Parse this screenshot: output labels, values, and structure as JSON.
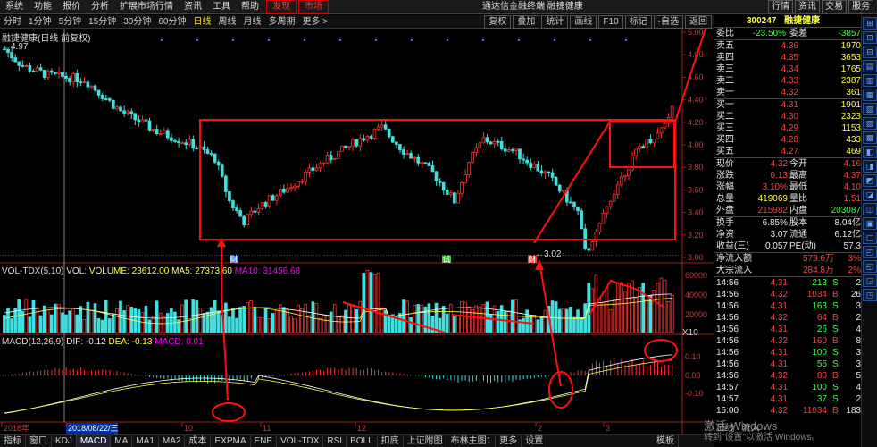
{
  "menu": {
    "items": [
      "系统",
      "功能",
      "报价",
      "分析",
      "扩展市场行情",
      "资讯",
      "工具",
      "帮助"
    ],
    "hot": [
      "发现",
      "市场"
    ],
    "title": "通达信金融终端 融捷健康",
    "right_buttons": [
      "行情",
      "资讯",
      "交易",
      "服务"
    ]
  },
  "toolbar": {
    "periods": [
      "分时",
      "1分钟",
      "5分钟",
      "15分钟",
      "30分钟",
      "60分钟",
      "日线",
      "周线",
      "月线",
      "多周期",
      "更多 >"
    ],
    "active": "日线",
    "right": [
      "复权",
      "叠加",
      "统计",
      "画线",
      "F10",
      "标记",
      "-自选",
      "返回"
    ]
  },
  "chart": {
    "name": "融捷健康(日线 前复权)",
    "start_price": "4.97",
    "low_label": "3.02",
    "price_axis": [
      "5.00",
      "4.80",
      "4.60",
      "4.40",
      "4.20",
      "4.00",
      "3.80",
      "3.60",
      "3.40",
      "3.20",
      "3.00"
    ],
    "vol_header": "VOL-TDX(5,10)  VOL: ",
    "vol_volume": "VOLUME: 23612.00",
    "vol_ma5": "MA5: 27373.60",
    "vol_ma10": "MA10: 31456.68",
    "vol_axis": [
      "60000",
      "40000",
      "20000"
    ],
    "vol_unit": "X10",
    "macd_header": "MACD(12,26,9)",
    "macd_dif": "DIF: -0.12",
    "macd_dea": "DEA: -0.13",
    "macd_val": "MACD: 0.01",
    "macd_axis": [
      "0.10",
      "0.00",
      "-0.10"
    ],
    "date_labels": [
      "2018年",
      "2018/08/22/三",
      "10",
      "11",
      "12",
      "2",
      "3"
    ],
    "markers": [
      "财",
      "试",
      "财"
    ]
  },
  "quote": {
    "code": "300247",
    "name": "融捷健康",
    "weibi_label": "委比",
    "weibi": "-23.50%",
    "weicha_label": "委差",
    "weicha": "-3857",
    "sell": [
      {
        "label": "卖五",
        "price": "4.36",
        "vol": "1970"
      },
      {
        "label": "卖四",
        "price": "4.35",
        "vol": "3653"
      },
      {
        "label": "卖三",
        "price": "4.34",
        "vol": "1765"
      },
      {
        "label": "卖二",
        "price": "4.33",
        "vol": "2387"
      },
      {
        "label": "卖一",
        "price": "4.32",
        "vol": "361"
      }
    ],
    "buy": [
      {
        "label": "买一",
        "price": "4.31",
        "vol": "1901"
      },
      {
        "label": "买二",
        "price": "4.30",
        "vol": "2323"
      },
      {
        "label": "买三",
        "price": "4.29",
        "vol": "1153"
      },
      {
        "label": "买四",
        "price": "4.28",
        "vol": "433"
      },
      {
        "label": "买五",
        "price": "4.27",
        "vol": "469"
      }
    ],
    "stats": [
      {
        "l1": "现价",
        "v1": "4.32",
        "l2": "今开",
        "v2": "4.16"
      },
      {
        "l1": "涨跌",
        "v1": "0.13",
        "l2": "最高",
        "v2": "4.37"
      },
      {
        "l1": "涨幅",
        "v1": "3.10%",
        "l2": "最低",
        "v2": "4.10"
      },
      {
        "l1": "总量",
        "v1": "419069",
        "l2": "量比",
        "v2": "1.51"
      },
      {
        "l1": "外盘",
        "v1": "215982",
        "l2": "内盘",
        "v2": "203087"
      }
    ],
    "stats2": [
      {
        "l1": "换手",
        "v1": "6.85%",
        "l2": "股本",
        "v2": "8.04亿"
      },
      {
        "l1": "净资",
        "v1": "3.07",
        "l2": "流通",
        "v2": "6.12亿"
      },
      {
        "l1": "收益(三)",
        "v1": "0.057",
        "l2": "PE(动)",
        "v2": "57.3"
      }
    ],
    "flow": [
      {
        "label": "净流入额",
        "value": "579.6万",
        "pct": "3%"
      },
      {
        "label": "大宗流入",
        "value": "284.8万",
        "pct": "2%"
      }
    ],
    "ticks": [
      {
        "t": "14:56",
        "p": "4.31",
        "v": "213",
        "s": "S",
        "n": "2"
      },
      {
        "t": "14:56",
        "p": "4.32",
        "v": "1034",
        "s": "B",
        "n": "26"
      },
      {
        "t": "14:56",
        "p": "4.31",
        "v": "163",
        "s": "S",
        "n": "3"
      },
      {
        "t": "14:56",
        "p": "4.32",
        "v": "64",
        "s": "B",
        "n": "2"
      },
      {
        "t": "14:56",
        "p": "4.31",
        "v": "26",
        "s": "S",
        "n": "4"
      },
      {
        "t": "14:56",
        "p": "4.32",
        "v": "160",
        "s": "B",
        "n": "8"
      },
      {
        "t": "14:56",
        "p": "4.31",
        "v": "100",
        "s": "S",
        "n": "3"
      },
      {
        "t": "14:56",
        "p": "4.31",
        "v": "55",
        "s": "S",
        "n": "3"
      },
      {
        "t": "14:56",
        "p": "4.32",
        "v": "80",
        "s": "B",
        "n": "5"
      },
      {
        "t": "14:57",
        "p": "4.31",
        "v": "100",
        "s": "S",
        "n": "4"
      },
      {
        "t": "14:57",
        "p": "4.31",
        "v": "37",
        "s": "S",
        "n": "2"
      },
      {
        "t": "15:00",
        "p": "4.32",
        "v": "11034",
        "s": "B",
        "n": "183"
      }
    ],
    "tabs": [
      "日线",
      "流入"
    ]
  },
  "bottom": {
    "items": [
      "指标",
      "窗口",
      "KDJ",
      "MACD",
      "MA",
      "MA1",
      "MA2",
      "成本",
      "EXPMA",
      "ENE",
      "VOL-TDX",
      "RSI",
      "BOLL",
      "扣底",
      "上证附图",
      "布林主图1",
      "更多",
      "设置"
    ],
    "active": "MACD",
    "right": "模板"
  },
  "sidebar": [
    "⊞",
    "⊡",
    "⊟",
    "▤",
    "▥",
    "▦",
    "▧",
    "▨",
    "▩",
    "◧",
    "◨",
    "◩",
    "◪",
    "◫",
    "▣",
    "▢",
    "◰",
    "◱",
    "◲",
    "◳"
  ],
  "watermark": {
    "line1": "激活 Windows",
    "line2": "转到\"设置\"以激活 Windows。"
  }
}
